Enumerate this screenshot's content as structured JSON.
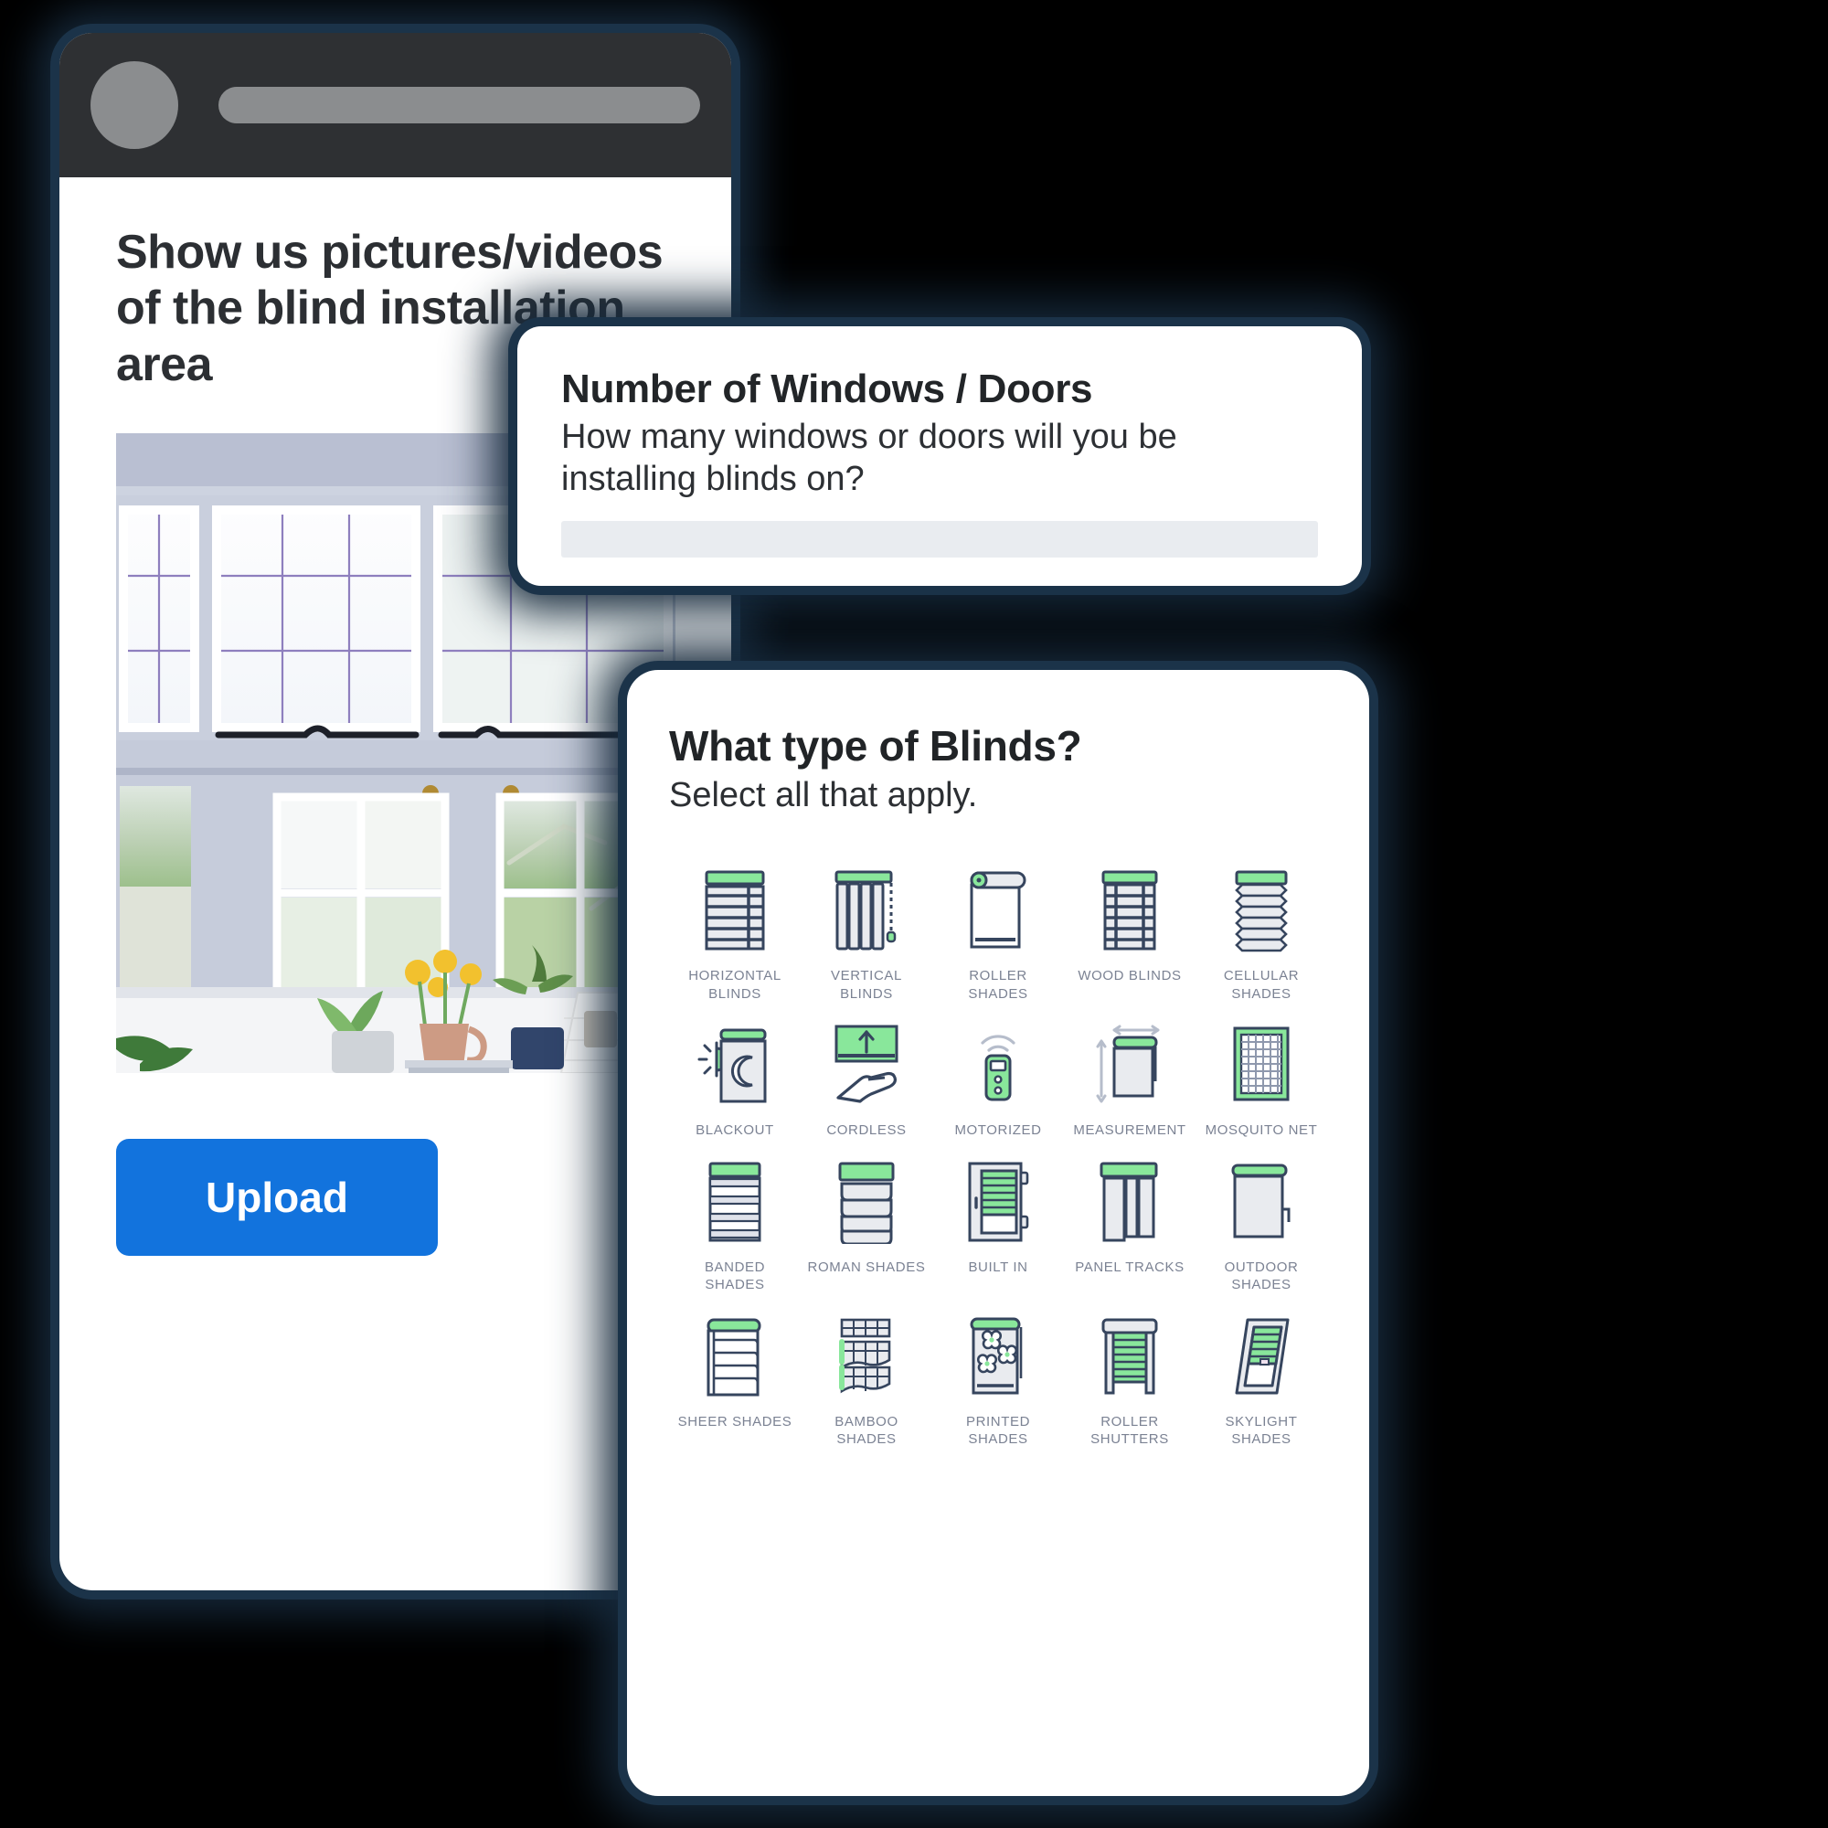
{
  "phone_card": {
    "topbar": {
      "avatar": "avatar-placeholder",
      "title_placeholder": "title-bar-placeholder"
    },
    "heading": "Show us pictures/videos of the blind installation area",
    "photo_alt": "bay-window-with-plants-photo",
    "upload_label": "Upload"
  },
  "windows_card": {
    "title": "Number of Windows / Doors",
    "subtitle": "How many windows or doors will you be installing blinds on?",
    "input_value": "",
    "input_placeholder": ""
  },
  "blinds_card": {
    "title": "What type of Blinds?",
    "subtitle": "Select all that apply.",
    "items": [
      {
        "label": "HORIZONTAL BLINDS",
        "icon": "horizontal-blinds-icon"
      },
      {
        "label": "VERTICAL BLINDS",
        "icon": "vertical-blinds-icon"
      },
      {
        "label": "ROLLER SHADES",
        "icon": "roller-shades-icon"
      },
      {
        "label": "WOOD BLINDS",
        "icon": "wood-blinds-icon"
      },
      {
        "label": "CELLULAR SHADES",
        "icon": "cellular-shades-icon"
      },
      {
        "label": "BLACKOUT",
        "icon": "blackout-icon"
      },
      {
        "label": "CORDLESS",
        "icon": "cordless-icon"
      },
      {
        "label": "MOTORIZED",
        "icon": "motorized-icon"
      },
      {
        "label": "MEASUREMENT",
        "icon": "measurement-icon"
      },
      {
        "label": "MOSQUITO NET",
        "icon": "mosquito-net-icon"
      },
      {
        "label": "BANDED SHADES",
        "icon": "banded-shades-icon"
      },
      {
        "label": "ROMAN SHADES",
        "icon": "roman-shades-icon"
      },
      {
        "label": "BUILT IN",
        "icon": "built-in-icon"
      },
      {
        "label": "PANEL TRACKS",
        "icon": "panel-tracks-icon"
      },
      {
        "label": "OUTDOOR SHADES",
        "icon": "outdoor-shades-icon"
      },
      {
        "label": "SHEER SHADES",
        "icon": "sheer-shades-icon"
      },
      {
        "label": "BAMBOO SHADES",
        "icon": "bamboo-shades-icon"
      },
      {
        "label": "PRINTED SHADES",
        "icon": "printed-shades-icon"
      },
      {
        "label": "ROLLER SHUTTERS",
        "icon": "roller-shutters-icon"
      },
      {
        "label": "SKYLIGHT SHADES",
        "icon": "skylight-shades-icon"
      }
    ]
  },
  "colors": {
    "background": "#000000",
    "card_glow": "#1b3349",
    "upload_button": "#1273dd",
    "icon_stroke": "#36455e",
    "icon_accent_green": "#89e79b",
    "icon_fill_gray": "#e9ebef",
    "label_text": "#7b8293",
    "topbar": "#2e3033",
    "input_bar": "#e9ecf0"
  }
}
